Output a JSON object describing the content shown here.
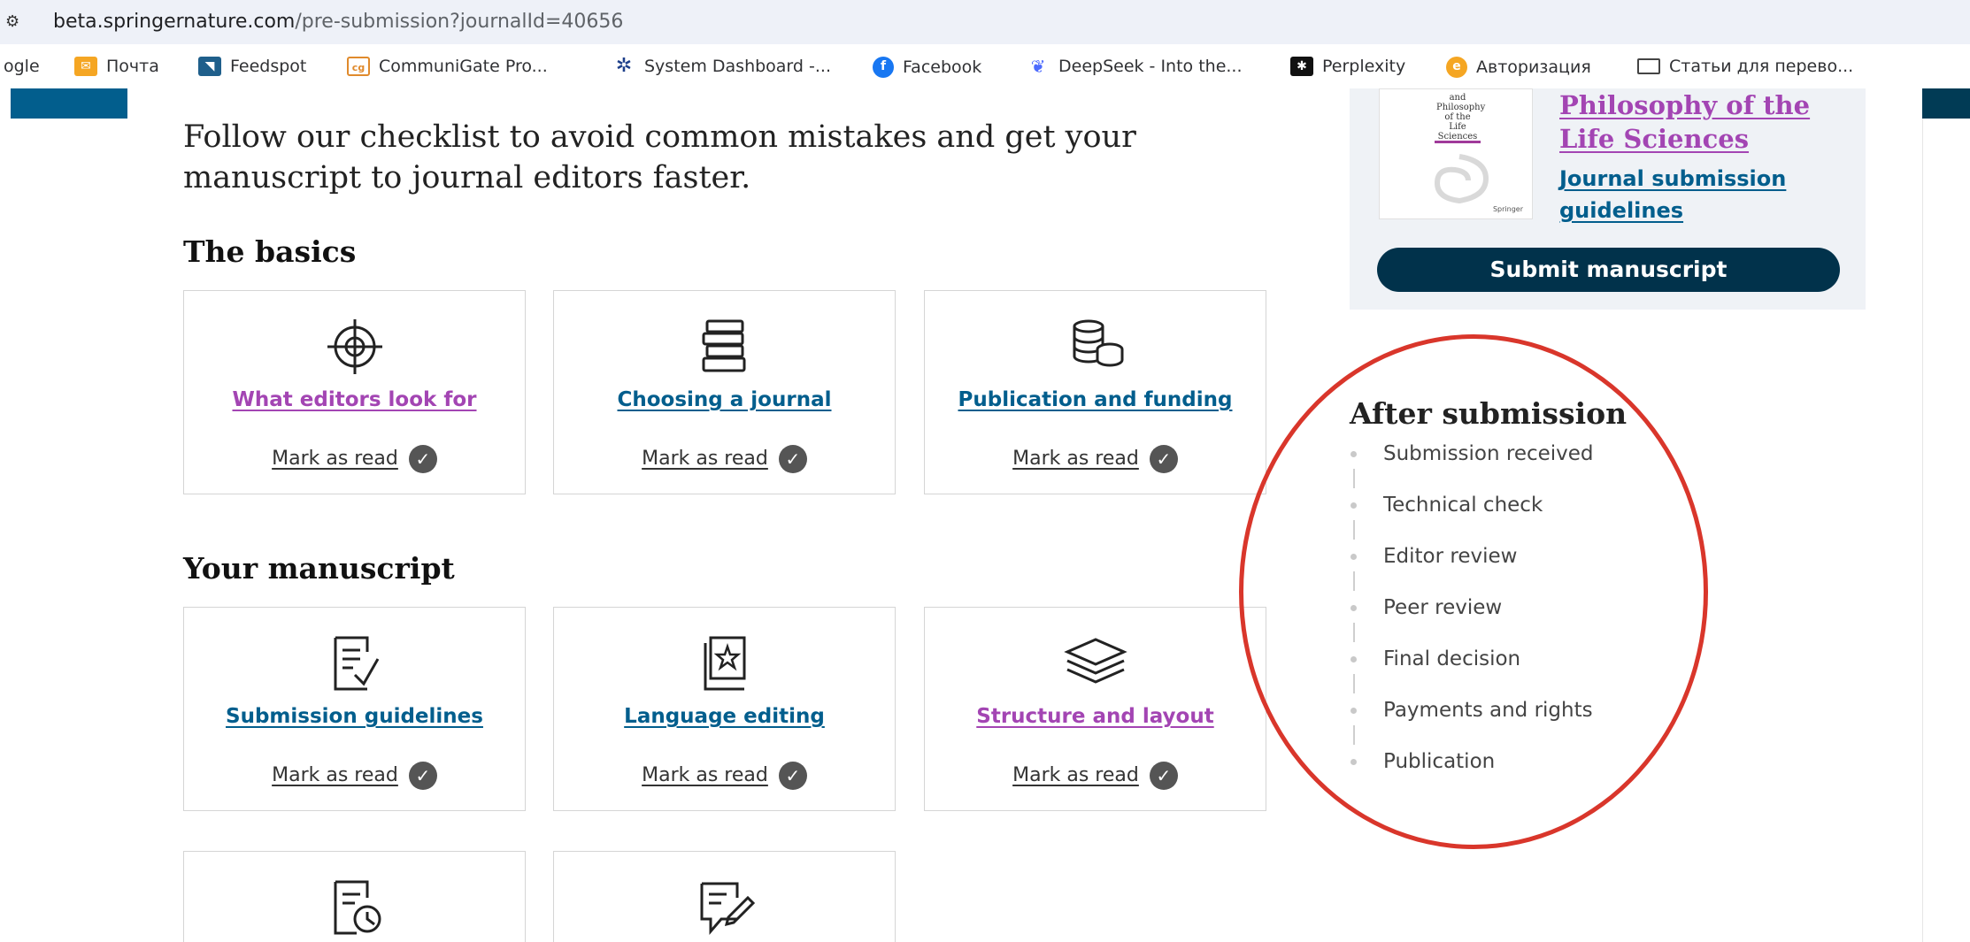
{
  "browser": {
    "url_host": "beta.springernature.com",
    "url_path": "/pre-submission?journalId=40656"
  },
  "bookmarks": [
    {
      "label": "ogle",
      "icon": "google-icon"
    },
    {
      "label": "Почта",
      "icon": "mail-icon"
    },
    {
      "label": "Feedspot",
      "icon": "feedspot-icon"
    },
    {
      "label": "CommuniGate Pro...",
      "icon": "communigate-icon"
    },
    {
      "label": "System Dashboard -...",
      "icon": "jira-icon"
    },
    {
      "label": "Facebook",
      "icon": "facebook-icon"
    },
    {
      "label": "DeepSeek - Into the...",
      "icon": "deepseek-icon"
    },
    {
      "label": "Perplexity",
      "icon": "perplexity-icon"
    },
    {
      "label": "Авторизация",
      "icon": "auth-icon"
    },
    {
      "label": "Статьи для перево...",
      "icon": "folder-icon"
    }
  ],
  "intro": "Follow our checklist to avoid common mistakes and get your manuscript to journal editors faster.",
  "sections": {
    "basics_title": "The basics",
    "manuscript_title": "Your manuscript"
  },
  "cards": {
    "editors": {
      "label": "What editors look for",
      "mark": "Mark as read",
      "icon": "target-icon"
    },
    "journal": {
      "label": "Choosing a journal",
      "mark": "Mark as read",
      "icon": "books-icon"
    },
    "funding": {
      "label": "Publication and funding",
      "mark": "Mark as read",
      "icon": "coins-icon"
    },
    "guidelines": {
      "label": "Submission guidelines",
      "mark": "Mark as read",
      "icon": "document-check-icon"
    },
    "language": {
      "label": "Language editing",
      "mark": "Mark as read",
      "icon": "star-book-icon"
    },
    "structure": {
      "label": "Structure and layout",
      "mark": "Mark as read",
      "icon": "layers-icon"
    },
    "extra1": {
      "icon": "document-clock-icon"
    },
    "extra2": {
      "icon": "edit-comment-icon"
    }
  },
  "journal": {
    "title_line1": "Philosophy of the",
    "title_line2": "Life Sciences",
    "guidelines_link": "Journal submission guidelines",
    "submit_label": "Submit manuscript",
    "cover_text_1": "and",
    "cover_text_2": "Philosophy",
    "cover_text_3": "of the",
    "cover_text_4": "Life",
    "cover_text_5": "Sciences",
    "cover_publisher": "Springer"
  },
  "after": {
    "title": "After submission",
    "steps": [
      "Submission received",
      "Technical check",
      "Editor review",
      "Peer review",
      "Final decision",
      "Payments and rights",
      "Publication"
    ]
  },
  "colors": {
    "link": "#025e8d",
    "visited": "#a345b3",
    "button": "#01324b",
    "annotation": "#d9362b"
  }
}
